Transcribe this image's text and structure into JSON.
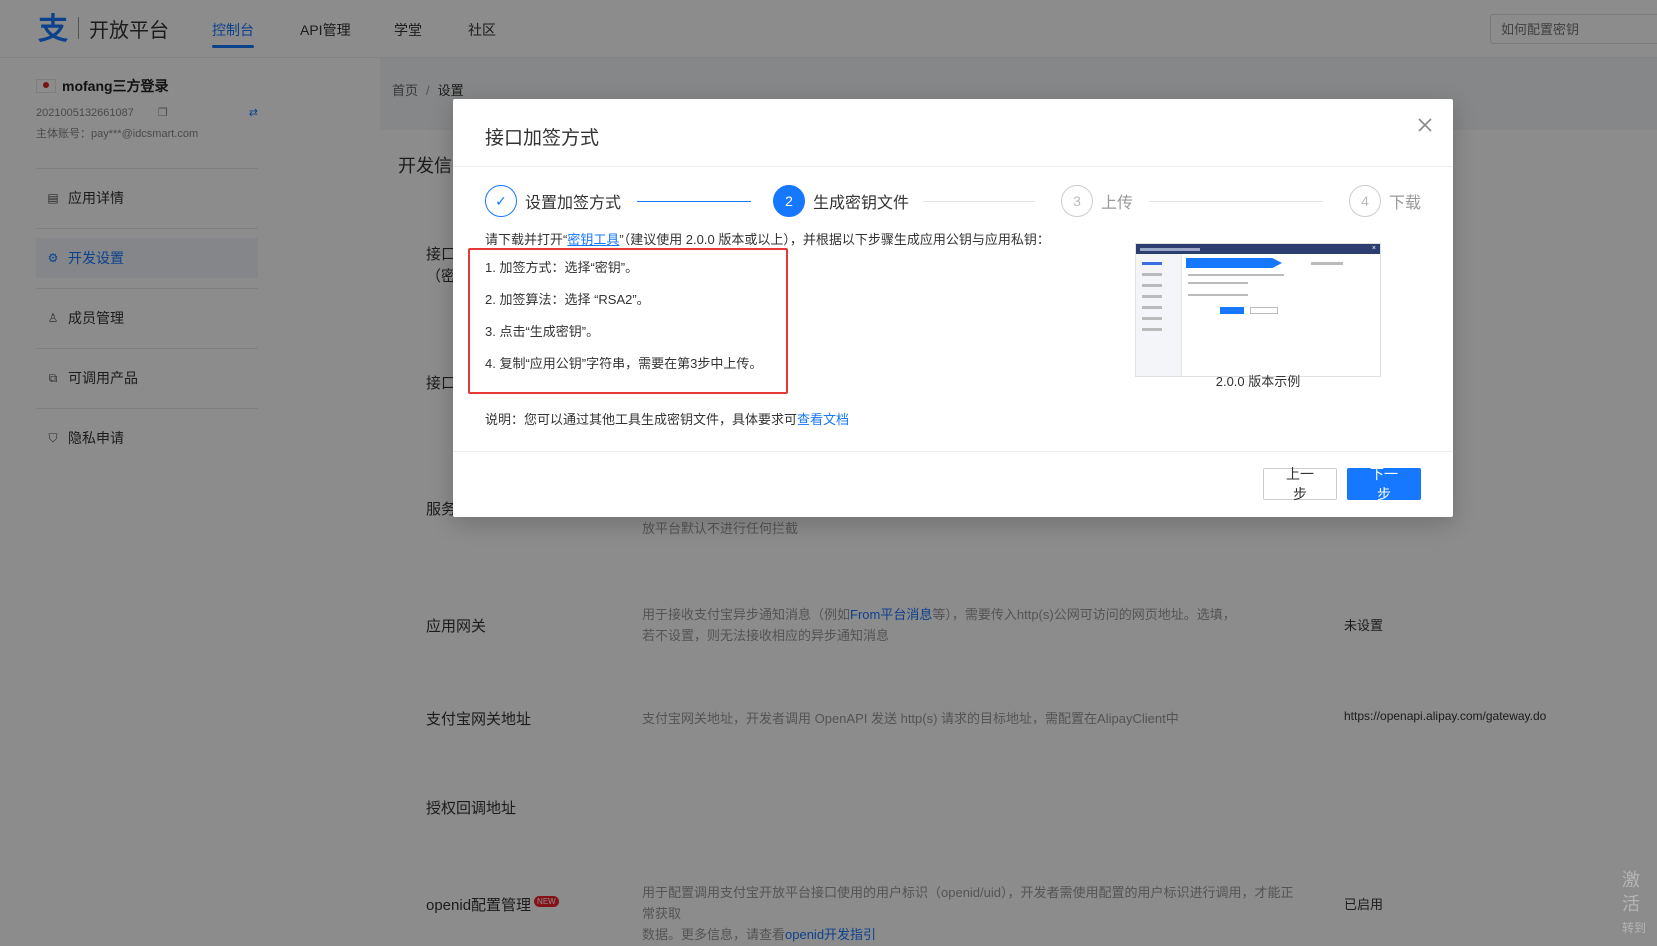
{
  "topnav": {
    "logo_text": "开放平台",
    "items": [
      {
        "label": "控制台",
        "active": true
      },
      {
        "label": "API管理"
      },
      {
        "label": "学堂"
      },
      {
        "label": "社区"
      }
    ],
    "search_placeholder": "如何配置密钥"
  },
  "sidebar": {
    "app_name": "mofang三方登录",
    "app_id": "2021005132661087",
    "owner": "主体账号：pay***@idcsmart.com",
    "items": [
      {
        "label": "应用详情",
        "icon": "chart-icon"
      },
      {
        "label": "开发设置",
        "icon": "settings-doc-icon",
        "active": true
      },
      {
        "label": "成员管理",
        "icon": "members-icon"
      },
      {
        "label": "可调用产品",
        "icon": "products-icon"
      },
      {
        "label": "隐私申请",
        "icon": "shield-icon"
      }
    ]
  },
  "breadcrumb": {
    "home": "首页",
    "current": "设置"
  },
  "main": {
    "card_title": "开发信",
    "rows": [
      {
        "label": "接口",
        "label2": "（密"
      },
      {
        "label": "接口"
      },
      {
        "label": "服务",
        "desc": "放平台默认不进行任何拦截"
      },
      {
        "label": "应用网关",
        "desc_prefix": "用于接收支付宝异步通知消息（例如",
        "desc_link": "From平台消息",
        "desc_suffix": "等），需要传入http(s)公网可访问的网页地址。选填，",
        "desc_line2": "若不设置，则无法接收相应的异步通知消息",
        "value": "未设置"
      },
      {
        "label": "支付宝网关地址",
        "desc": "支付宝网关地址，开发者调用 OpenAPI 发送 http(s) 请求的目标地址，需配置在AlipayClient中",
        "value": "https://openapi.alipay.com/gateway.do"
      },
      {
        "label": "授权回调地址"
      },
      {
        "label": "openid配置管理",
        "badge": "NEW",
        "desc": "用于配置调用支付宝开放平台接口使用的用户标识（openid/uid），开发者需使用配置的用户标识进行调用，才能正常获取",
        "desc_line2_prefix": "数据。更多信息，请查看",
        "desc_link": "openid开发指引",
        "value": "已启用"
      }
    ]
  },
  "modal": {
    "title": "接口加签方式",
    "steps": [
      {
        "label": "设置加签方式",
        "number": "✓",
        "state": "done"
      },
      {
        "label": "生成密钥文件",
        "number": "2",
        "state": "current"
      },
      {
        "label": "上传",
        "number": "3",
        "state": "todo"
      },
      {
        "label": "下载",
        "number": "4",
        "state": "todo"
      }
    ],
    "intro_prefix": "请下载并打开“",
    "intro_link": "密钥工具",
    "intro_suffix": "”（建议使用 2.0.0 版本或以上），并根据以下步骤生成应用公钥与应用私钥：",
    "instructions": [
      "1. 加签方式：选择“密钥”。",
      "2. 加签算法：选择 “RSA2”。",
      "3. 点击“生成密钥”。",
      "4. 复制“应用公钥”字符串，需要在第3步中上传。"
    ],
    "note_prefix": "说明：您可以通过其他工具生成密钥文件，具体要求可",
    "note_link": "查看文档",
    "example_caption": "2.0.0 版本示例",
    "prev_label": "上一步",
    "next_label": "下一步"
  },
  "watermark": {
    "line1": "激活",
    "line2": "转到"
  }
}
